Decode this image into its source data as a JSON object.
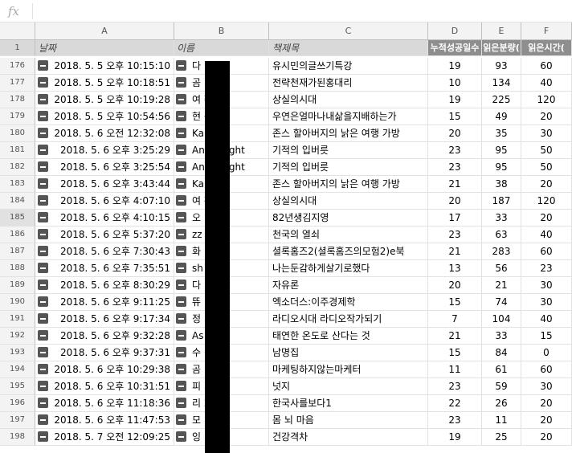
{
  "formula_bar": {
    "fx_label": "fx",
    "value": ""
  },
  "columns": {
    "row_header": "",
    "a": "A",
    "b": "B",
    "c": "C",
    "d": "D",
    "e": "E",
    "f": "F"
  },
  "header_row": {
    "num": "1",
    "a": "날짜",
    "b": "이름",
    "c": "책제목",
    "d": "누적성공일수",
    "e": "읽은분량(",
    "f": "읽은시간("
  },
  "selected_row": "185",
  "rows": [
    {
      "n": "176",
      "date": "2018. 5. 5 오후 10:15:10",
      "name": "다",
      "title": "유시민의글쓰기특강",
      "d": "19",
      "e": "93",
      "f": "60"
    },
    {
      "n": "177",
      "date": "2018. 5. 5 오후 10:18:51",
      "name": "곰",
      "title": "전략천재가된홍대리",
      "d": "10",
      "e": "134",
      "f": "40"
    },
    {
      "n": "178",
      "date": "2018. 5. 5 오후 10:19:28",
      "name": "여        황",
      "title": "상실의시대",
      "d": "19",
      "e": "225",
      "f": "120"
    },
    {
      "n": "179",
      "date": "2018. 5. 5 오후 10:54:56",
      "name": "현        동",
      "title": "우연은얼마나내삶을지배하는가",
      "d": "15",
      "e": "49",
      "f": "20"
    },
    {
      "n": "180",
      "date": "2018. 5. 6 오전 12:32:08",
      "name": "Ka",
      "title": "존스 할아버지의 낡은 여행 가방",
      "d": "20",
      "e": "35",
      "f": "30"
    },
    {
      "n": "181",
      "date": "2018. 5. 6 오후 3:25:29",
      "name": "An        keNight",
      "title": "기적의 입버릇",
      "d": "23",
      "e": "95",
      "f": "50"
    },
    {
      "n": "182",
      "date": "2018. 5. 6 오후 3:25:54",
      "name": "An        keNight",
      "title": "기적의 입버릇",
      "d": "23",
      "e": "95",
      "f": "50"
    },
    {
      "n": "183",
      "date": "2018. 5. 6 오후 3:43:44",
      "name": "Ka",
      "title": " 존스 할아버지의 낡은 여행 가방",
      "d": "21",
      "e": "38",
      "f": "20"
    },
    {
      "n": "184",
      "date": "2018. 5. 6 오후 4:07:10",
      "name": "여        황",
      "title": "상실의시대",
      "d": "20",
      "e": "187",
      "f": "120"
    },
    {
      "n": "185",
      "date": "2018. 5. 6 오후 4:10:15",
      "name": "오",
      "title": "82년생김지영",
      "d": "17",
      "e": "33",
      "f": "20"
    },
    {
      "n": "186",
      "date": "2018. 5. 6 오후 5:37:20",
      "name": "zz",
      "title": "천국의 열쇠",
      "d": "23",
      "e": "63",
      "f": "40"
    },
    {
      "n": "187",
      "date": "2018. 5. 6 오후 7:30:43",
      "name": "화",
      "title": "셜록홈즈2(셜록홈즈의모험2)e북",
      "d": "21",
      "e": "283",
      "f": "60"
    },
    {
      "n": "188",
      "date": "2018. 5. 6 오후 7:35:51",
      "name": "sh        nes",
      "title": "나는둔감하게살기로했다",
      "d": "13",
      "e": "56",
      "f": "23"
    },
    {
      "n": "189",
      "date": "2018. 5. 6 오후 8:30:29",
      "name": "다",
      "title": "자유론",
      "d": "20",
      "e": "21",
      "f": "30"
    },
    {
      "n": "190",
      "date": "2018. 5. 6 오후 9:11:25",
      "name": "뜌",
      "title": "엑소더스:이주경제학",
      "d": "15",
      "e": "74",
      "f": "30"
    },
    {
      "n": "191",
      "date": "2018. 5. 6 오후 9:17:34",
      "name": "정",
      "title": "라디오시대 라디오작가되기",
      "d": "7",
      "e": "104",
      "f": "40"
    },
    {
      "n": "192",
      "date": "2018. 5. 6 오후 9:32:28",
      "name": "As",
      "title": "태연한 온도로 산다는 것",
      "d": "21",
      "e": "33",
      "f": "15"
    },
    {
      "n": "193",
      "date": "2018. 5. 6 오후 9:37:31",
      "name": "수",
      "title": "남명집",
      "d": "15",
      "e": "84",
      "f": "0"
    },
    {
      "n": "194",
      "date": "2018. 5. 6 오후 10:29:38",
      "name": "곰",
      "title": "마케팅하지않는마케터",
      "d": "11",
      "e": "61",
      "f": "60"
    },
    {
      "n": "195",
      "date": "2018. 5. 6 오후 10:31:51",
      "name": "피",
      "title": "넛지",
      "d": "23",
      "e": "59",
      "f": "30"
    },
    {
      "n": "196",
      "date": "2018. 5. 6 오후 11:18:36",
      "name": "리        2",
      "title": "한국사를보다1",
      "d": "22",
      "e": "26",
      "f": "20"
    },
    {
      "n": "197",
      "date": "2018. 5. 6 오후 11:47:53",
      "name": "모",
      "title": "몸 뇌 마음",
      "d": "23",
      "e": "11",
      "f": "20"
    },
    {
      "n": "198",
      "date": "2018. 5. 7 오전 12:09:25",
      "name": "잉",
      "title": "건강격차",
      "d": "19",
      "e": "25",
      "f": "20"
    }
  ]
}
